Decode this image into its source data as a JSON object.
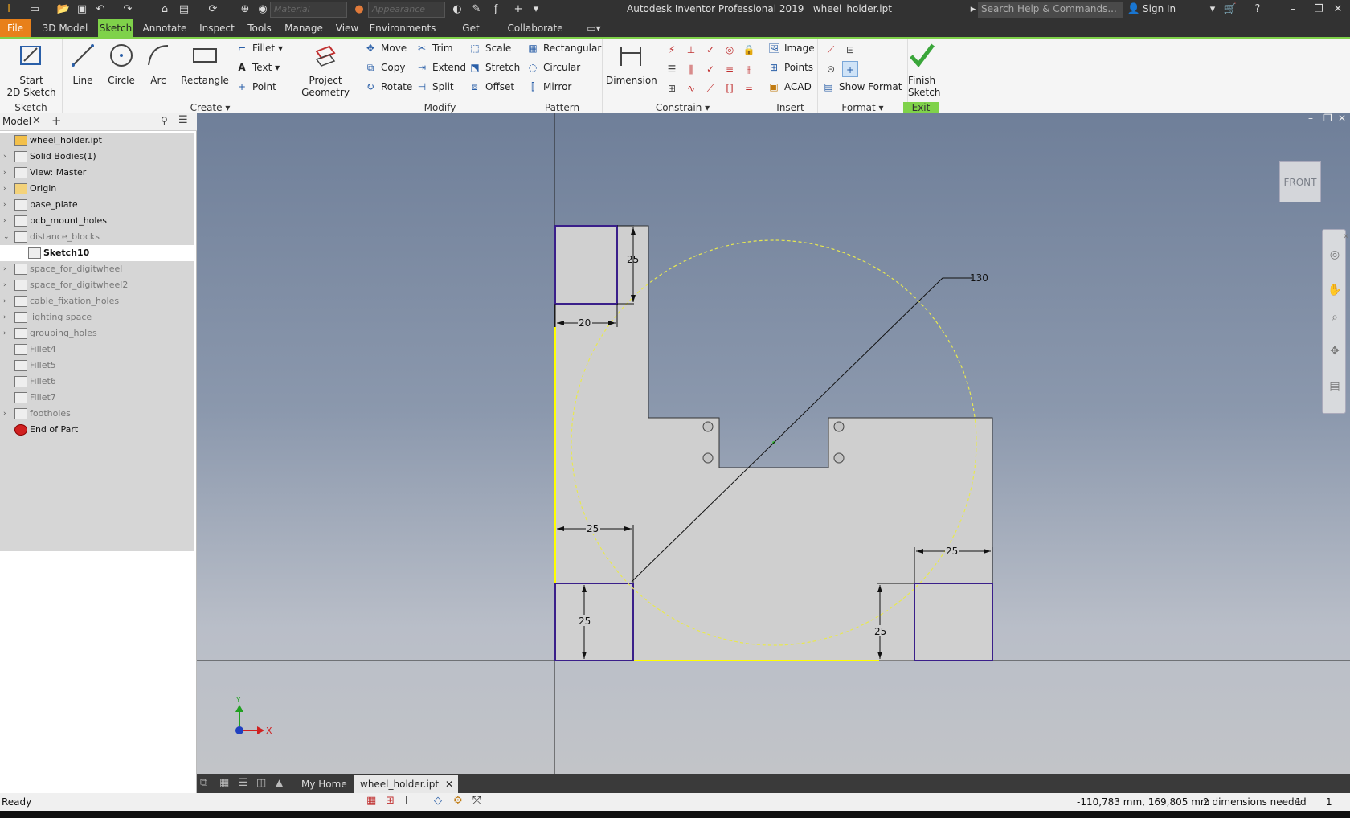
{
  "app": {
    "title": "Autodesk Inventor Professional 2019",
    "file": "wheel_holder.ipt"
  },
  "qat": {
    "material_placeholder": "Material",
    "appearance_placeholder": "Appearance"
  },
  "search": {
    "placeholder": "Search Help & Commands..."
  },
  "signin": {
    "label": "Sign In"
  },
  "menu_tabs": [
    "File",
    "3D Model",
    "Sketch",
    "Annotate",
    "Inspect",
    "Tools",
    "Manage",
    "View",
    "Environments",
    "Get Started",
    "Collaborate"
  ],
  "ribbon": {
    "sketch_panel": {
      "label": "Sketch",
      "start_2d": "Start\n2D Sketch"
    },
    "create_panel": {
      "label": "Create",
      "line": "Line",
      "circle": "Circle",
      "arc": "Arc",
      "rectangle": "Rectangle",
      "fillet": "Fillet",
      "text": "Text",
      "point": "Point",
      "project_geometry": "Project\nGeometry"
    },
    "modify_panel": {
      "label": "Modify",
      "move": "Move",
      "copy": "Copy",
      "rotate": "Rotate",
      "trim": "Trim",
      "extend": "Extend",
      "split": "Split",
      "scale": "Scale",
      "stretch": "Stretch",
      "offset": "Offset"
    },
    "pattern_panel": {
      "label": "Pattern",
      "rectangular": "Rectangular",
      "circular": "Circular",
      "mirror": "Mirror"
    },
    "constrain_panel": {
      "label": "Constrain",
      "dimension": "Dimension"
    },
    "insert_panel": {
      "label": "Insert",
      "image": "Image",
      "points": "Points",
      "acad": "ACAD"
    },
    "format_panel": {
      "label": "Format",
      "show_format": "Show Format"
    },
    "exit_panel": {
      "label": "Exit",
      "finish_sketch": "Finish\nSketch"
    }
  },
  "browser": {
    "tab": "Model",
    "items": [
      {
        "label": "wheel_holder.ipt",
        "expander": "",
        "dim": false,
        "sel": false,
        "indent": 0
      },
      {
        "label": "Solid Bodies(1)",
        "expander": "›",
        "dim": false,
        "sel": false,
        "indent": 0
      },
      {
        "label": "View: Master",
        "expander": "›",
        "dim": false,
        "sel": false,
        "indent": 0
      },
      {
        "label": "Origin",
        "expander": "›",
        "dim": false,
        "sel": false,
        "indent": 0
      },
      {
        "label": "base_plate",
        "expander": "›",
        "dim": false,
        "sel": false,
        "indent": 0
      },
      {
        "label": "pcb_mount_holes",
        "expander": "›",
        "dim": false,
        "sel": false,
        "indent": 0
      },
      {
        "label": "distance_blocks",
        "expander": "⌄",
        "dim": true,
        "sel": false,
        "indent": 0
      },
      {
        "label": "Sketch10",
        "expander": "",
        "dim": false,
        "sel": true,
        "indent": 1
      },
      {
        "label": "space_for_digitwheel",
        "expander": "›",
        "dim": true,
        "sel": false,
        "indent": 0
      },
      {
        "label": "space_for_digitwheel2",
        "expander": "›",
        "dim": true,
        "sel": false,
        "indent": 0
      },
      {
        "label": "cable_fixation_holes",
        "expander": "›",
        "dim": true,
        "sel": false,
        "indent": 0
      },
      {
        "label": "lighting space",
        "expander": "›",
        "dim": true,
        "sel": false,
        "indent": 0
      },
      {
        "label": "grouping_holes",
        "expander": "›",
        "dim": true,
        "sel": false,
        "indent": 0
      },
      {
        "label": "Fillet4",
        "expander": "",
        "dim": true,
        "sel": false,
        "indent": 0
      },
      {
        "label": "Fillet5",
        "expander": "",
        "dim": true,
        "sel": false,
        "indent": 0
      },
      {
        "label": "Fillet6",
        "expander": "",
        "dim": true,
        "sel": false,
        "indent": 0
      },
      {
        "label": "Fillet7",
        "expander": "",
        "dim": true,
        "sel": false,
        "indent": 0
      },
      {
        "label": "footholes",
        "expander": "›",
        "dim": true,
        "sel": false,
        "indent": 0
      },
      {
        "label": "End of Part",
        "expander": "",
        "dim": false,
        "sel": false,
        "indent": 0
      }
    ]
  },
  "viewport": {
    "viewcube_face": "FRONT",
    "dimensions": {
      "d_top_h": "25",
      "d_top_w": "20",
      "d_diameter": "130",
      "d_bl_w": "25",
      "d_bl_h": "25",
      "d_br_w": "25",
      "d_br_h": "25"
    },
    "axis_x": "X",
    "axis_y": "Y"
  },
  "doc_tabs": {
    "home": "My Home",
    "file": "wheel_holder.ipt"
  },
  "status": {
    "text": "Ready",
    "coords": "-110,783 mm, 169,805 mm",
    "dims_needed": "2 dimensions needed",
    "count1": "1",
    "count2": "1"
  }
}
